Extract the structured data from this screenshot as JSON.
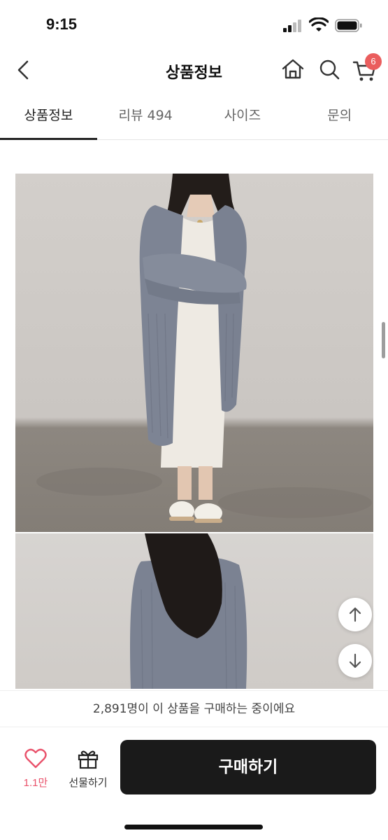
{
  "status_bar": {
    "time": "9:15"
  },
  "header": {
    "title": "상품정보",
    "cart_count": "6"
  },
  "tabs": [
    {
      "label": "상품정보",
      "active": true
    },
    {
      "label": "리뷰 494",
      "active": false
    },
    {
      "label": "사이즈",
      "active": false
    },
    {
      "label": "문의",
      "active": false
    }
  ],
  "icons": {
    "back": "chevron-left-icon",
    "home": "home-icon",
    "search": "search-icon",
    "cart": "cart-icon",
    "scroll_up": "arrow-up-icon",
    "scroll_down": "arrow-down-icon",
    "like": "heart-icon",
    "gift": "gift-icon"
  },
  "purchase_notice": "2,891명이 이 상품을 구매하는 중이에요",
  "bottom_bar": {
    "like_count": "1.1만",
    "gift_label": "선물하기",
    "buy_label": "구매하기"
  },
  "colors": {
    "accent": "#ea5d5d",
    "like": "#e9526b",
    "buy_button": "#1a1a1a"
  }
}
